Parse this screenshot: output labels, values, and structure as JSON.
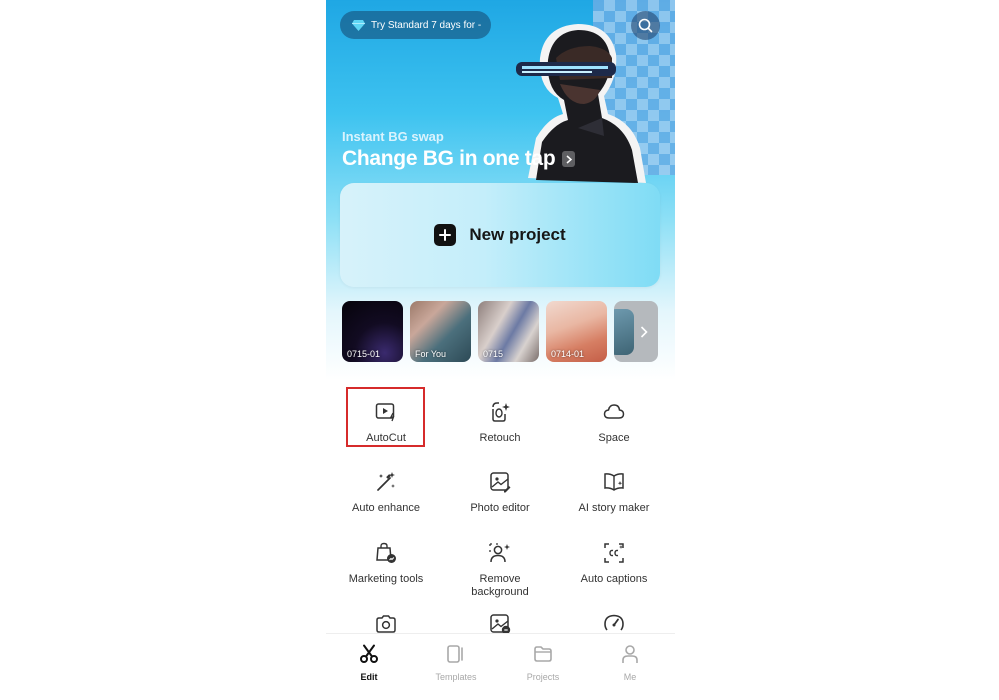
{
  "header": {
    "trial_label": "Try Standard 7 days for -",
    "search_icon": "search-icon"
  },
  "banner": {
    "subtitle": "Instant BG swap",
    "title": "Change BG in one tap"
  },
  "new_project": {
    "label": "New project"
  },
  "recent_projects": [
    {
      "name": "0715-01"
    },
    {
      "name": "For You"
    },
    {
      "name": "0715"
    },
    {
      "name": "0714-01"
    }
  ],
  "tools": [
    {
      "label": "AutoCut",
      "icon": "autocut-icon"
    },
    {
      "label": "Retouch",
      "icon": "retouch-icon"
    },
    {
      "label": "Space",
      "icon": "cloud-icon"
    },
    {
      "label": "Auto enhance",
      "icon": "magic-wand-icon"
    },
    {
      "label": "Photo editor",
      "icon": "photo-edit-icon"
    },
    {
      "label": "AI story maker",
      "icon": "book-icon"
    },
    {
      "label": "Marketing tools",
      "icon": "marketing-bag-icon"
    },
    {
      "label": "Remove\nbackground",
      "icon": "remove-bg-icon"
    },
    {
      "label": "Auto captions",
      "icon": "captions-icon"
    }
  ],
  "tabbar": [
    {
      "label": "Edit",
      "active": true
    },
    {
      "label": "Templates",
      "active": false
    },
    {
      "label": "Projects",
      "active": false
    },
    {
      "label": "Me",
      "active": false
    }
  ],
  "colors": {
    "accent_highlight": "#d62b2b",
    "banner_blue": "#1fa7e4"
  }
}
